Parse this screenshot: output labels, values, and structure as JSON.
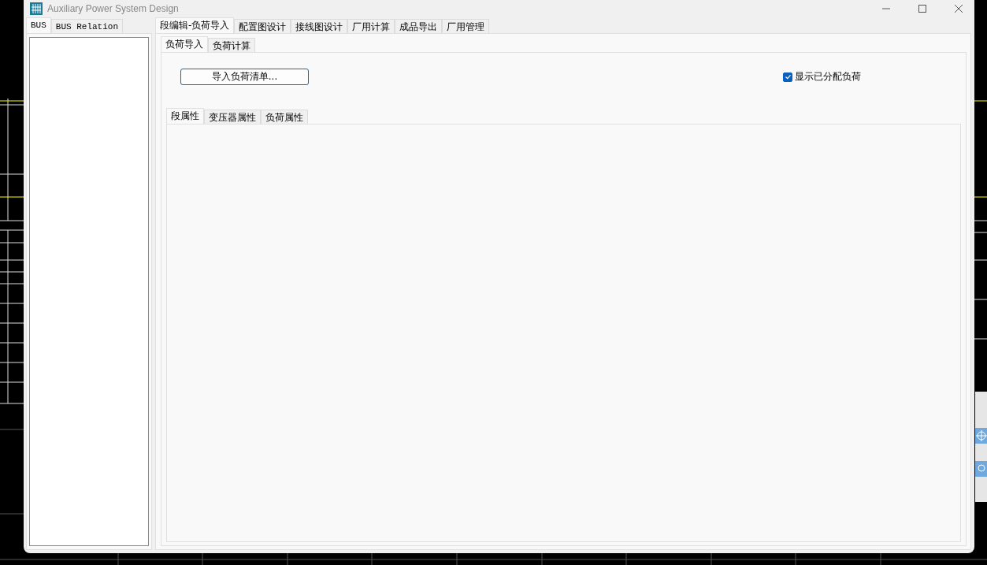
{
  "window": {
    "title": "Auxiliary Power System Design"
  },
  "left_tabs": [
    {
      "label": "BUS",
      "selected": true
    },
    {
      "label": "BUS Relation",
      "selected": false
    }
  ],
  "main_tabs": [
    {
      "label": "段编辑-负荷导入",
      "selected": true
    },
    {
      "label": "配置图设计",
      "selected": false
    },
    {
      "label": "接线图设计",
      "selected": false
    },
    {
      "label": "厂用计算",
      "selected": false
    },
    {
      "label": "成品导出",
      "selected": false
    },
    {
      "label": "厂用管理",
      "selected": false
    }
  ],
  "sub_tabs": [
    {
      "label": "负荷导入",
      "selected": true
    },
    {
      "label": "负荷计算",
      "selected": false
    }
  ],
  "import_button": {
    "label": "导入负荷清单..."
  },
  "show_assigned": {
    "label": "显示已分配负荷",
    "checked": true
  },
  "property_tabs": [
    {
      "label": "段属性",
      "selected": true
    },
    {
      "label": "变压器属性",
      "selected": false
    },
    {
      "label": "负荷属性",
      "selected": false
    }
  ]
}
